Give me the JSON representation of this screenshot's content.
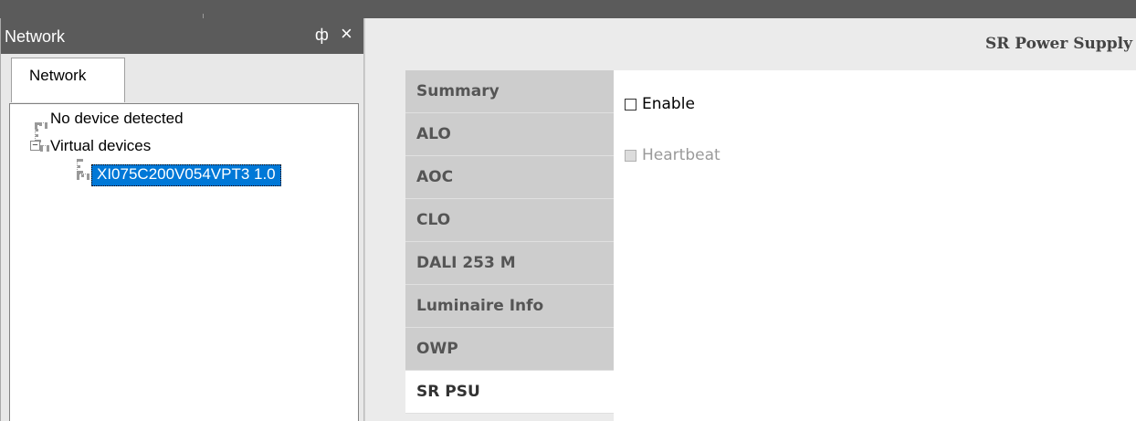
{
  "network_panel": {
    "title": "Network",
    "pin_glyph": "ф",
    "close_glyph": "×",
    "tab_label": "Network",
    "tree": {
      "no_device": "No device detected",
      "virtual_devices": "Virtual devices",
      "expander_glyph": "−",
      "selected_device": "XI075C200V054VPT3 1.0"
    }
  },
  "content": {
    "section_title": "SR Power Supply",
    "tabs": [
      {
        "label": "Summary"
      },
      {
        "label": "ALO"
      },
      {
        "label": "AOC"
      },
      {
        "label": "CLO"
      },
      {
        "label": "DALI 253 M"
      },
      {
        "label": "Luminaire Info"
      },
      {
        "label": "OWP"
      },
      {
        "label": "SR PSU"
      }
    ],
    "active_tab": "SR PSU",
    "options": {
      "enable_label": "Enable",
      "heartbeat_label": "Heartbeat"
    }
  },
  "colors": {
    "selection": "#0078d7",
    "header_bg": "#5b5b5b",
    "tab_bg": "#cdcdcd"
  }
}
